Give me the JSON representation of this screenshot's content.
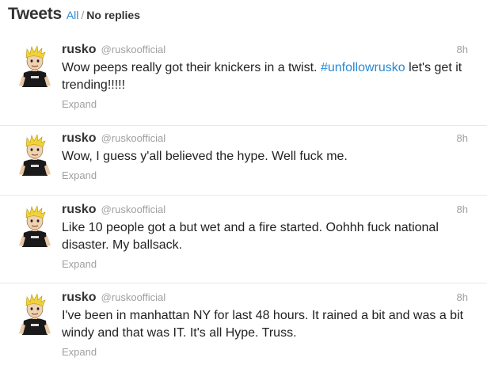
{
  "header": {
    "title": "Tweets",
    "filter_all": "All",
    "separator": "/",
    "filter_no_replies": "No replies"
  },
  "colors": {
    "link": "#2a8ad4",
    "muted": "#a0a0a0",
    "text": "#222222"
  },
  "tweets": [
    {
      "name": "rusko",
      "handle": "@ruskoofficial",
      "time": "8h",
      "text_before": "Wow peeps really got their knickers in a twist. ",
      "hashtag": "#unfollowrusko",
      "text_after": " let's get it trending!!!!!",
      "expand": "Expand"
    },
    {
      "name": "rusko",
      "handle": "@ruskoofficial",
      "time": "8h",
      "text_before": "Wow, I guess y'all believed the hype. Well fuck me.",
      "expand": "Expand"
    },
    {
      "name": "rusko",
      "handle": "@ruskoofficial",
      "time": "8h",
      "text_before": "Like 10 people got a but wet and a fire started. Oohhh fuck national disaster. My ballsack.",
      "expand": "Expand"
    },
    {
      "name": "rusko",
      "handle": "@ruskoofficial",
      "time": "8h",
      "text_before": "I've been in manhattan NY for last 48 hours. It rained a bit and was a bit windy and that was IT. It's all Hype. Truss.",
      "expand": "Expand"
    }
  ]
}
